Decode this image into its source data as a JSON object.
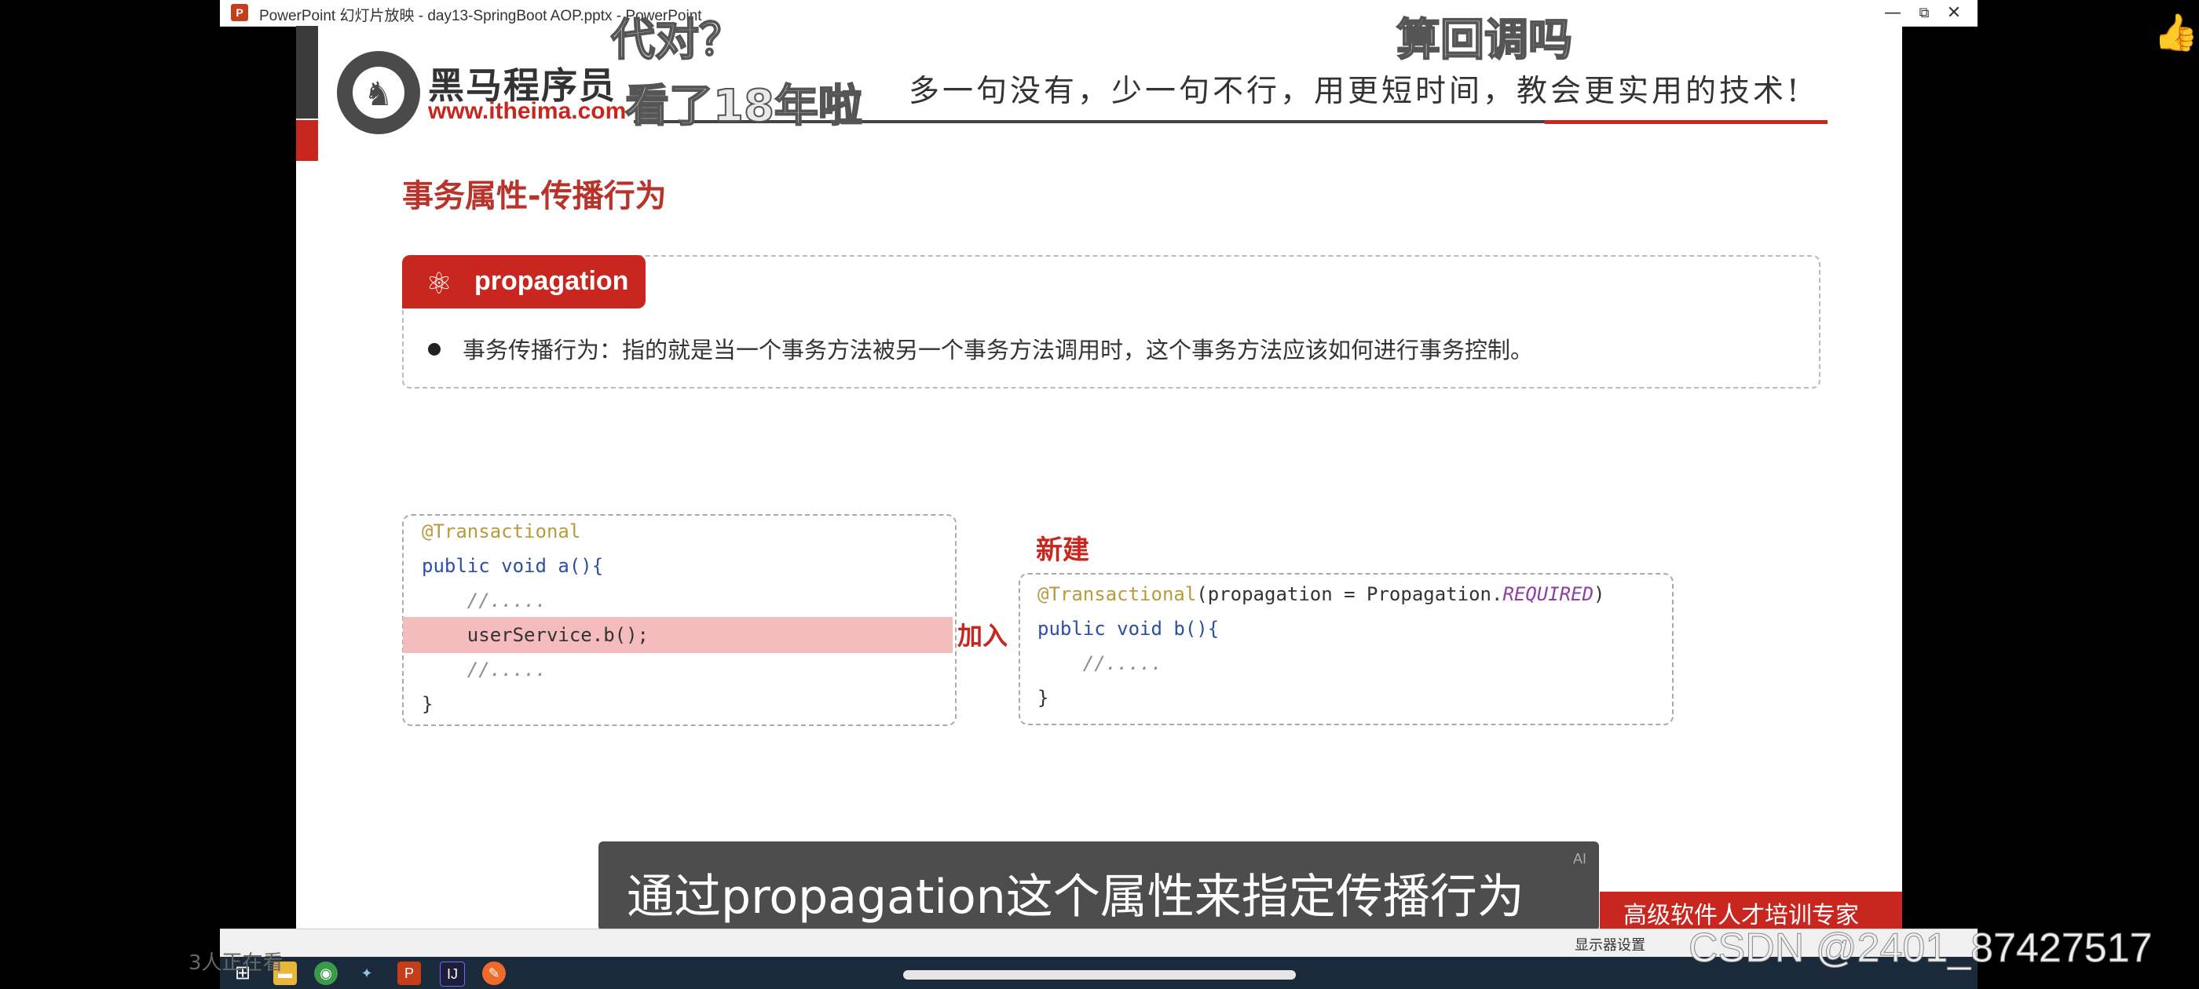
{
  "window": {
    "title": "PowerPoint 幻灯片放映 - day13-SpringBoot AOP.pptx - PowerPoint",
    "app_icon": "P",
    "minimize": "—",
    "restore": "⧉",
    "close": "✕"
  },
  "slide": {
    "brand": "黑马程序员",
    "brand_url": "www.itheima.com",
    "slogan": "多一句没有，少一句不行，用更短时间，教会更实用的技术!",
    "heading": "事务属性-传播行为",
    "tag_label": "propagation",
    "bullet": "事务传播行为：指的就是当一个事务方法被另一个事务方法调用时，这个事务方法应该如何进行事务控制。",
    "code_a": {
      "l1": "@Transactional",
      "l2_kw": "public void",
      "l2_rest": " a(){",
      "l3": "    //.....",
      "l4": "    userService.b();",
      "l5": "    //.....",
      "l6": "}"
    },
    "code_b": {
      "l1_ann": "@Transactional",
      "l1_mid": "(propagation = Propagation.",
      "l1_const": "REQUIRED",
      "l1_end": ")",
      "l2_kw": "public void",
      "l2_rest": " b(){",
      "l3": "    //.....",
      "l4": "}"
    },
    "handwritten_join": "加入",
    "handwritten_new": "新建",
    "corner_text": "高级软件人才培训专家"
  },
  "danmaku": {
    "d1": "代对？",
    "d2": "看了18年啦",
    "d3": "算回调吗"
  },
  "subtitle": {
    "text": "通过propagation这个属性来指定传播行为",
    "badge": "AI"
  },
  "status": {
    "display_settings": "显示器设置"
  },
  "viewers": "3人正在看",
  "watermark": "CSDN @2401_87427517",
  "icons": {
    "thumb": "👍"
  }
}
